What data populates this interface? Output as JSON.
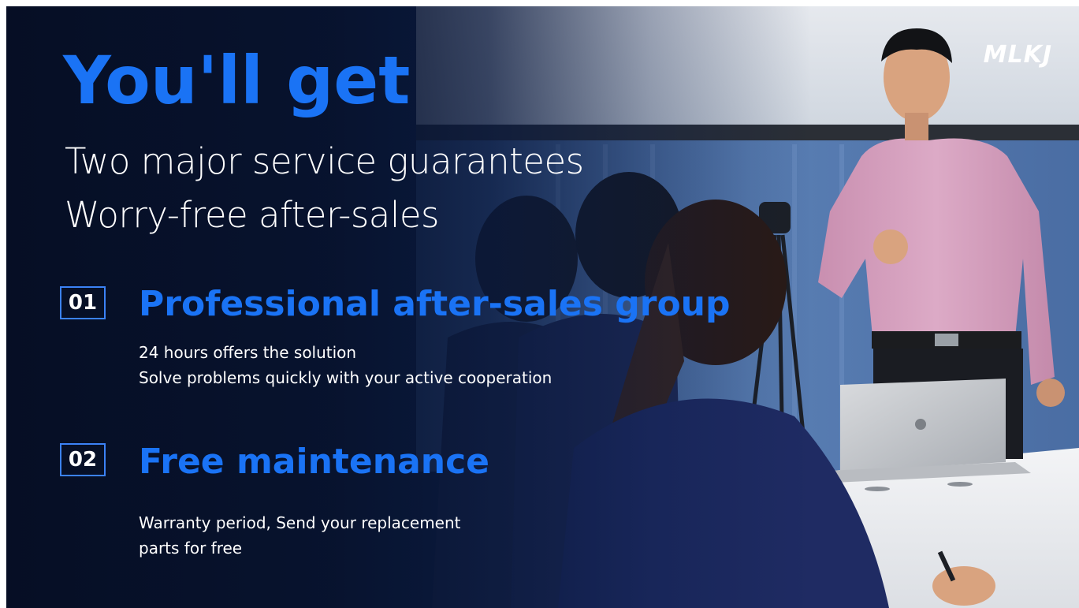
{
  "brand": {
    "logo": "MLKJ"
  },
  "headline": "You'll get",
  "subheadline": {
    "line1": "Two major service guarantees",
    "line2": "Worry-free after-sales"
  },
  "sections": [
    {
      "number": "01",
      "title": "Professional after-sales group",
      "lines": [
        "24 hours offers the solution",
        "Solve problems quickly with your active cooperation"
      ]
    },
    {
      "number": "02",
      "title": "Free maintenance",
      "lines": [
        "Warranty period, Send your replacement",
        "parts for free"
      ]
    }
  ],
  "colors": {
    "accent": "#1a73f5",
    "background": "#0b1a33",
    "text": "#ffffff"
  }
}
